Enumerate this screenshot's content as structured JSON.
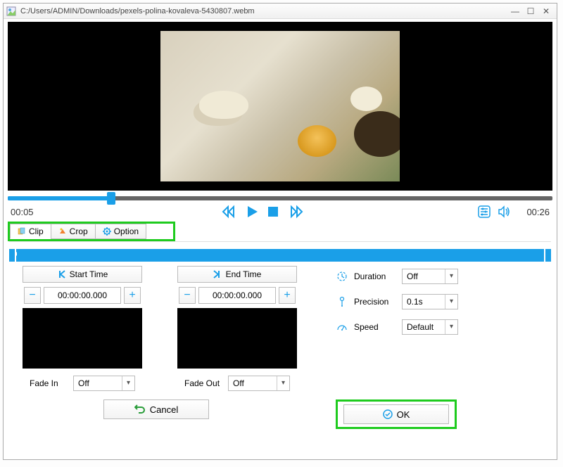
{
  "window": {
    "title": "C:/Users/ADMIN/Downloads/pexels-polina-kovaleva-5430807.webm"
  },
  "player": {
    "current_time": "00:05",
    "total_time": "00:26",
    "progress_pct": 19
  },
  "tabs": {
    "clip": "Clip",
    "crop": "Crop",
    "option": "Option"
  },
  "clip": {
    "start_time_label": "Start Time",
    "end_time_label": "End Time",
    "start_time_value": "00:00:00.000",
    "end_time_value": "00:00:00.000",
    "fade_in_label": "Fade In",
    "fade_out_label": "Fade Out",
    "fade_in_value": "Off",
    "fade_out_value": "Off"
  },
  "options": {
    "duration_label": "Duration",
    "duration_value": "Off",
    "precision_label": "Precision",
    "precision_value": "0.1s",
    "speed_label": "Speed",
    "speed_value": "Default"
  },
  "footer": {
    "cancel": "Cancel",
    "ok": "OK"
  },
  "icons": {
    "minus": "−",
    "plus": "+"
  }
}
